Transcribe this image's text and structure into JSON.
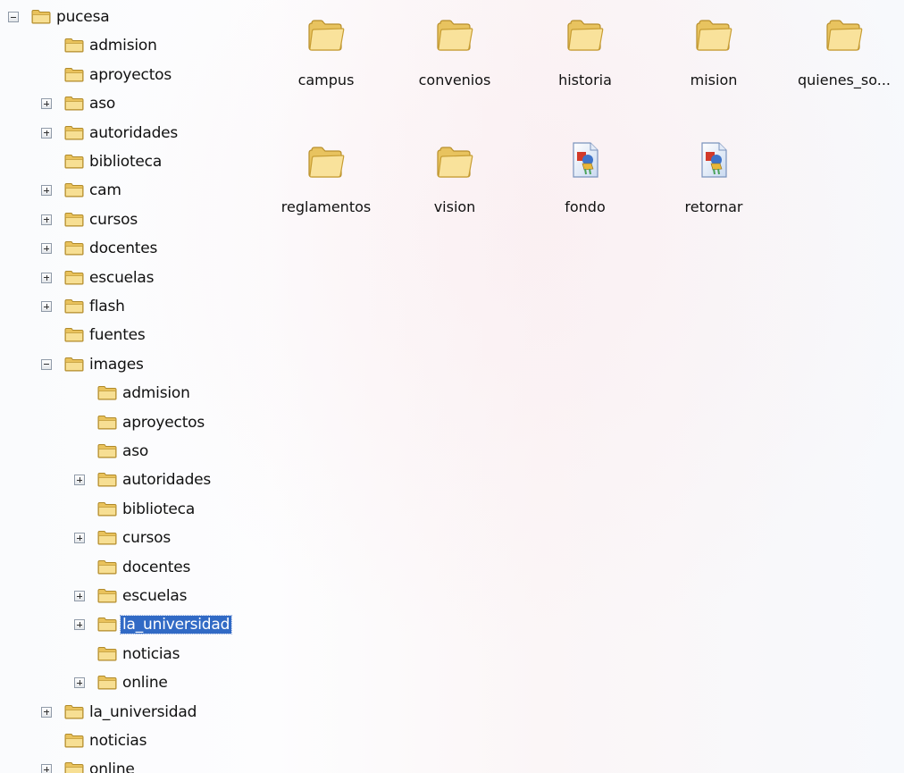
{
  "tree": {
    "items": [
      {
        "label": "pucesa",
        "expander": "minus",
        "selected": false
      },
      {
        "label": "admision",
        "expander": "none",
        "selected": false
      },
      {
        "label": "aproyectos",
        "expander": "none",
        "selected": false
      },
      {
        "label": "aso",
        "expander": "plus",
        "selected": false
      },
      {
        "label": "autoridades",
        "expander": "plus",
        "selected": false
      },
      {
        "label": "biblioteca",
        "expander": "none",
        "selected": false
      },
      {
        "label": "cam",
        "expander": "plus",
        "selected": false
      },
      {
        "label": "cursos",
        "expander": "plus",
        "selected": false
      },
      {
        "label": "docentes",
        "expander": "plus",
        "selected": false
      },
      {
        "label": "escuelas",
        "expander": "plus",
        "selected": false
      },
      {
        "label": "flash",
        "expander": "plus",
        "selected": false
      },
      {
        "label": "fuentes",
        "expander": "none",
        "selected": false
      },
      {
        "label": "images",
        "expander": "minus",
        "selected": false
      },
      {
        "label": "admision",
        "expander": "none",
        "selected": false
      },
      {
        "label": "aproyectos",
        "expander": "none",
        "selected": false
      },
      {
        "label": "aso",
        "expander": "none",
        "selected": false
      },
      {
        "label": "autoridades",
        "expander": "plus",
        "selected": false
      },
      {
        "label": "biblioteca",
        "expander": "none",
        "selected": false
      },
      {
        "label": "cursos",
        "expander": "plus",
        "selected": false
      },
      {
        "label": "docentes",
        "expander": "none",
        "selected": false
      },
      {
        "label": "escuelas",
        "expander": "plus",
        "selected": false
      },
      {
        "label": "la_universidad",
        "expander": "plus",
        "selected": true
      },
      {
        "label": "noticias",
        "expander": "none",
        "selected": false
      },
      {
        "label": "online",
        "expander": "plus",
        "selected": false
      },
      {
        "label": "la_universidad",
        "expander": "plus",
        "selected": false
      },
      {
        "label": "noticias",
        "expander": "none",
        "selected": false
      },
      {
        "label": "online",
        "expander": "plus",
        "selected": false
      }
    ]
  },
  "files": {
    "items": [
      {
        "label": "campus",
        "icon": "folder-icon"
      },
      {
        "label": "convenios",
        "icon": "folder-icon"
      },
      {
        "label": "historia",
        "icon": "folder-icon"
      },
      {
        "label": "mision",
        "icon": "folder-icon"
      },
      {
        "label": "quienes_so...",
        "icon": "folder-icon"
      },
      {
        "label": "reglamentos",
        "icon": "folder-icon"
      },
      {
        "label": "vision",
        "icon": "folder-icon"
      },
      {
        "label": "fondo",
        "icon": "image-file-icon"
      },
      {
        "label": "retornar",
        "icon": "image-file-icon"
      }
    ]
  },
  "colors": {
    "selection": "#316ac5",
    "folder": "#f3d57a"
  }
}
